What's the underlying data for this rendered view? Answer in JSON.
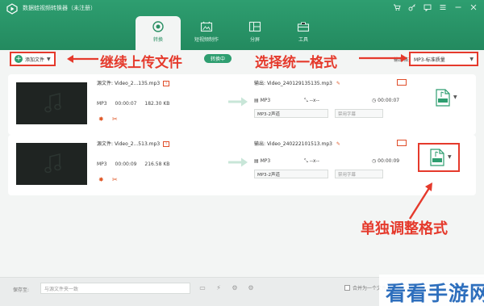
{
  "app": {
    "title": "数据蛙视频转换器（未注册）"
  },
  "tabs": [
    {
      "label": "转换",
      "icon": "convert-icon",
      "active": true
    },
    {
      "label": "短视频制作",
      "icon": "video-icon",
      "active": false
    },
    {
      "label": "分屏",
      "icon": "split-screen-icon",
      "active": false
    },
    {
      "label": "工具",
      "icon": "toolbox-icon",
      "active": false
    }
  ],
  "toolbar": {
    "add_file_label": "添加文件",
    "converting_badge": "转换中",
    "format_label": "输出格式:",
    "format_value": "MP3-标准质量"
  },
  "annotations": {
    "continue_upload": "继续上传文件",
    "unified_format": "选择统一格式",
    "individual_format": "单独调整格式"
  },
  "files": [
    {
      "source_label": "源文件:",
      "source_name": "Video_2...135.mp3",
      "format": "MP3",
      "duration": "00:00:07",
      "size": "182.30 KB",
      "output_label": "输出:",
      "output_name": "Video_240129135135.mp3",
      "out_format": "MP3",
      "out_resolution": "--x--",
      "out_duration": "00:00:07",
      "audio_channel": "MP3-2声道",
      "subtitle": "禁用字幕"
    },
    {
      "source_label": "源文件:",
      "source_name": "Video_2...513.mp3",
      "format": "MP3",
      "duration": "00:00:09",
      "size": "216.58 KB",
      "output_label": "输出:",
      "output_name": "Video_240222101513.mp3",
      "out_format": "MP3",
      "out_resolution": "--x--",
      "out_duration": "00:00:09",
      "audio_channel": "MP3-2声道",
      "subtitle": "禁用字幕"
    }
  ],
  "bottom": {
    "save_label": "保存至:",
    "save_value": "与源文件夹一致",
    "merge_label": "合并为一个文件"
  },
  "watermark": "看看手游网",
  "colors": {
    "brand_green": "#2e9e70",
    "annotation_red": "#e53a2c",
    "watermark_blue": "#2e6fbd"
  }
}
